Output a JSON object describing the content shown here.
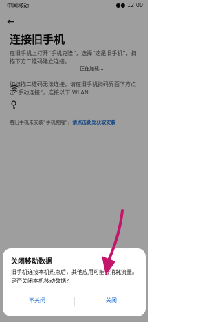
{
  "status_bar": {
    "left": "中国移动",
    "right": "●● 12:00"
  },
  "page": {
    "title": "连接旧手机",
    "instruction": "在旧手机上打开“手机克隆”，选择“这是旧手机”，扫描下方二维码建立连接。",
    "loading": "正在加载...",
    "fallback": "如扫描二维码无法连接，请在旧手机扫码界面下方点击“手动连接”，连接以下 WLAN:",
    "footer_prefix": "若旧手机未安装“手机克隆”，",
    "footer_link": "请点击此处获取安装"
  },
  "icons": {
    "back": "back-arrow-icon",
    "wifi": "wifi-icon",
    "key": "key-icon"
  },
  "dialog": {
    "title": "关闭移动数据",
    "message": "旧手机连接本机热点后，其他应用可能会消耗流量。是否关闭本机移动数据？",
    "cancel_label": "不关闭",
    "confirm_label": "关闭"
  },
  "colors": {
    "accent": "#1e6fd0",
    "annotation": "#c4146b"
  }
}
